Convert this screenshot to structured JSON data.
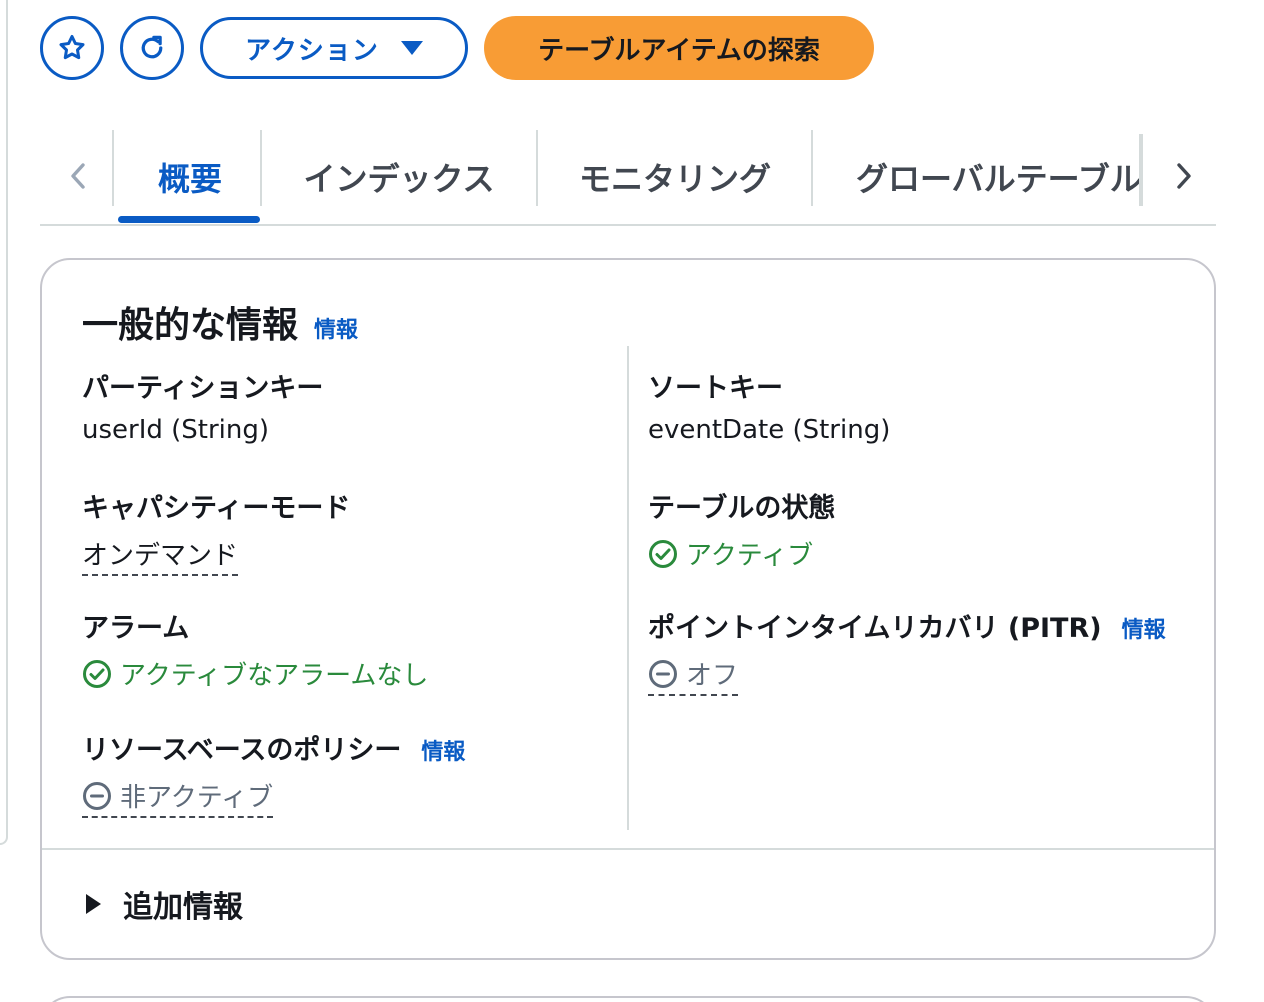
{
  "toolbar": {
    "actions_label": "アクション",
    "explore_label": "テーブルアイテムの探索"
  },
  "tabs": [
    {
      "label": "概要",
      "active": true
    },
    {
      "label": "インデックス",
      "active": false
    },
    {
      "label": "モニタリング",
      "active": false
    },
    {
      "label": "グローバルテーブル",
      "active": false
    }
  ],
  "panel": {
    "title": "一般的な情報",
    "info_label": "情報",
    "fields": {
      "partition_key": {
        "label": "パーティションキー",
        "value": "userId (String)"
      },
      "sort_key": {
        "label": "ソートキー",
        "value": "eventDate (String)"
      },
      "capacity_mode": {
        "label": "キャパシティーモード",
        "value": "オンデマンド"
      },
      "table_status": {
        "label": "テーブルの状態",
        "value": "アクティブ"
      },
      "alarms": {
        "label": "アラーム",
        "value": "アクティブなアラームなし"
      },
      "pitr": {
        "label": "ポイントインタイムリカバリ (PITR)",
        "info": "情報",
        "value": "オフ"
      },
      "resource_policy": {
        "label": "リソースベースのポリシー",
        "info": "情報",
        "value": "非アクティブ"
      }
    },
    "footer": {
      "expander_label": "追加情報"
    }
  },
  "colors": {
    "link_blue": "#0a5bc4",
    "primary_orange": "#f89c35",
    "success_green": "#2a8a3c",
    "inactive_grey": "#5f6b7a"
  },
  "icons": {
    "favorite": "star-icon",
    "refresh": "refresh-icon",
    "actions_dropdown": "caret-down-icon",
    "tabs_prev": "chevron-left-icon",
    "tabs_next": "chevron-right-icon",
    "status_success": "check-circle-icon",
    "status_stopped": "minus-circle-icon",
    "expander": "caret-right-icon"
  }
}
